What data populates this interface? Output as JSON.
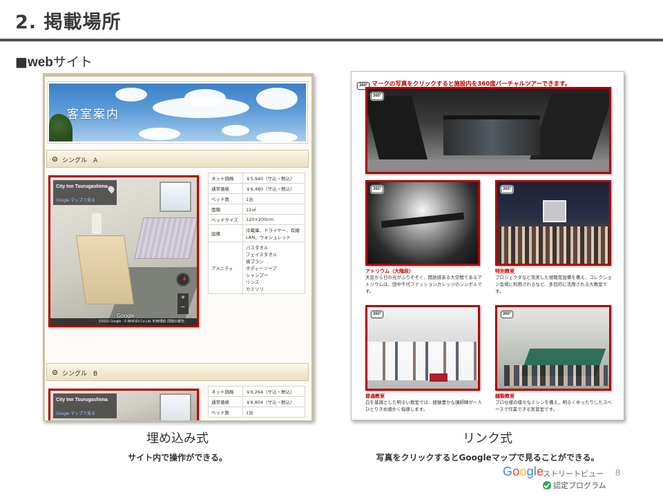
{
  "slide": {
    "title": "2. 掲載場所",
    "section_prefix": "■",
    "section_web": "web",
    "section_suffix": "サイト",
    "page_number": "8"
  },
  "left": {
    "banner_title": "客室案内",
    "rooms": [
      {
        "label": "シングル　A",
        "streetview": {
          "hotel_name": "City Inn Tsurugashima",
          "gmap_link": "Google マップで見る",
          "google_mark": "Google",
          "footer": "©2016 Google - © BRIDDI Co.Ltd.   利用規約   問題の報告",
          "zoom_in": "+",
          "zoom_out": "−"
        },
        "spec": [
          {
            "k": "ネット価格",
            "v": "￥5,940（サ込・税込）"
          },
          {
            "k": "通常価格",
            "v": "￥6,480（サ込・税込）"
          },
          {
            "k": "ベッド数",
            "v": "1台"
          },
          {
            "k": "面積",
            "v": "12㎡"
          },
          {
            "k": "ベッドサイズ",
            "v": "120×200cm"
          },
          {
            "k": "設備",
            "v": "冷蔵庫、ドライヤー、有線LAN、ウォシュレット"
          },
          {
            "k": "アメニティ",
            "v": "バスタオル\nフェイスタオル\n歯ブラシ\nボディーソープ\nシャンプー\nリンス\nカミソリ"
          }
        ]
      },
      {
        "label": "シングル　B",
        "streetview": {
          "hotel_name": "City Inn Tsurugashima",
          "gmap_link": "Google マップで見る"
        },
        "spec": [
          {
            "k": "ネット価格",
            "v": "￥6,264（サ込・税込）"
          },
          {
            "k": "通常価格",
            "v": "￥6,804（サ込・税込）"
          },
          {
            "k": "ベッド数",
            "v": "1台"
          }
        ]
      }
    ],
    "caption_main": "埋め込み式",
    "caption_sub": "サイト内で操作ができる。"
  },
  "right": {
    "badge": "360°",
    "header_text": "マークの写真をクリックすると施設内を360度バーチャルツアーできます。",
    "places": [
      {
        "title": "アトリウム（大階段）",
        "desc": "天窓から日の光がふりそそぐ、開放感ある大空間であるアトリウムは、田中千代ファッションカレッジのシンボルです。"
      },
      {
        "title": "特別教室",
        "desc": "プロジェクタなど充実した視聴覚設備を備え、コレクション会場に利用されるなど、多目的に活用される大教室です。"
      },
      {
        "title": "普通教室",
        "desc": "白を基調とした明るい教室では、経験豊かな講師陣が一人ひとりきめ細かく指導します。"
      },
      {
        "title": "縫製教室",
        "desc": "プロ仕様の様々なミシンを備え、明るくゆったりしたスペースで作業できる実習室です。"
      }
    ],
    "caption_main": "リンク式",
    "caption_sub": "写真をクリックするとGoogleマップで見ることができる。"
  },
  "footer": {
    "google_letters": [
      "G",
      "o",
      "o",
      "g",
      "l",
      "e"
    ],
    "streetview_label": "ストリートビュー",
    "certified_label": "認定プログラム"
  },
  "colors": {
    "accent_red": "#b40000",
    "header_red": "#c00000",
    "rule_gray": "#555555"
  }
}
